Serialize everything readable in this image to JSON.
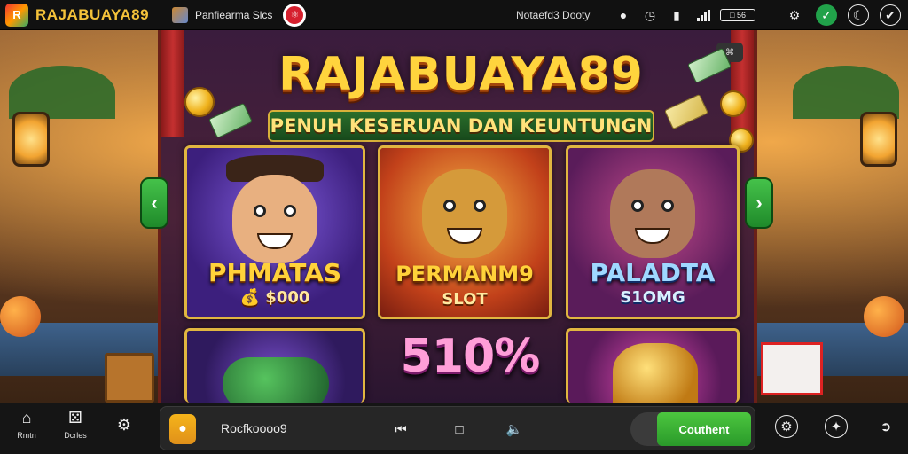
{
  "topbar": {
    "brand_name": "RAJABUAYA89",
    "brand_logo_letter": "R",
    "tab_label": "Panfiearma Slcs",
    "status_text": "Notaefd3 Dooty",
    "battery_text": "□ 56",
    "icons": [
      "location-icon",
      "clock-icon",
      "battery-icon",
      "signal-icon",
      "gear-icon",
      "check-icon",
      "moon-icon",
      "settings-icon"
    ]
  },
  "stage": {
    "title": "RAJABUAYA89",
    "subtitle": "PENUH KESERUAN DAN KEUNTUNGN",
    "corner_badge": "⌘"
  },
  "cards": [
    {
      "name": "PHMATAS",
      "sub": "💰 $000"
    },
    {
      "name": "PERMANM9",
      "sub": "SLOT"
    },
    {
      "name": "PALADTA",
      "sub": "S1OMG"
    }
  ],
  "promo_text": "510%",
  "bottom": {
    "home_label": "Rmtn",
    "dice_label": "Dcrles",
    "player_text": "Rocfkoooo9",
    "cta_label": "Couthent"
  },
  "colors": {
    "accent_gold": "#ffd43d",
    "accent_green": "#2a9a2a",
    "brand_red": "#d6202e"
  }
}
